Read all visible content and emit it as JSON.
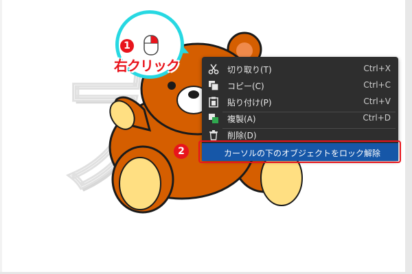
{
  "background_letter": "大",
  "callout": {
    "step": "1",
    "label": "右クリック"
  },
  "menu": {
    "items": [
      {
        "icon": "scissors-icon",
        "label": "切り取り(T)",
        "shortcut": "Ctrl+X"
      },
      {
        "icon": "copy-icon",
        "label": "コピー(C)",
        "shortcut": "Ctrl+C"
      },
      {
        "icon": "paste-icon",
        "label": "貼り付け(P)",
        "shortcut": "Ctrl+V"
      },
      {
        "icon": "duplicate-icon",
        "label": "複製(A)",
        "shortcut": "Ctrl+D"
      },
      {
        "icon": "trash-icon",
        "label": "削除(D)",
        "shortcut": ""
      }
    ],
    "highlighted": {
      "step": "2",
      "label": "カーソルの下のオブジェクトをロック解除"
    }
  },
  "colors": {
    "accent_red": "#e8141c",
    "callout_cyan": "#27d8e2",
    "menu_bg": "#2e2e2e",
    "highlight_blue": "#1657a8",
    "bear_brown": "#d55e00"
  }
}
